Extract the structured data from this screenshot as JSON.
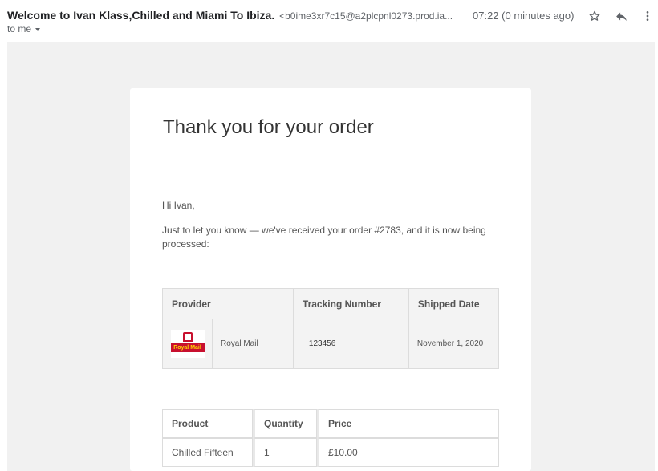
{
  "email": {
    "sender_name": "Welcome to Ivan Klass,Chilled and Miami To Ibiza.",
    "sender_address": "<b0ime3xr7c15@a2plcpnl0273.prod.ia...",
    "time": "07:22 (0 minutes ago)",
    "recipient": "to me",
    "icons": [
      "star-icon",
      "reply-icon",
      "more-vert-icon"
    ]
  },
  "body": {
    "heading": "Thank you for your order",
    "greeting": "Hi Ivan,",
    "message": "Just to let you know — we've received your order #2783, and it is now being processed:"
  },
  "tracking": {
    "headers": {
      "provider": "Provider",
      "tracking_number": "Tracking Number",
      "shipped_date": "Shipped Date"
    },
    "row": {
      "logo_text": "Royal Mail",
      "provider": "Royal Mail",
      "tracking_number": "123456",
      "shipped_date": "November 1, 2020"
    }
  },
  "products": {
    "headers": {
      "product": "Product",
      "quantity": "Quantity",
      "price": "Price"
    },
    "rows": [
      {
        "product": "Chilled Fifteen",
        "quantity": "1",
        "price": "£10.00"
      }
    ]
  },
  "colors": {
    "background": "#f1f1f1",
    "card": "#ffffff",
    "royal_mail_red": "#c8102e",
    "royal_mail_yellow": "#ffd500"
  }
}
